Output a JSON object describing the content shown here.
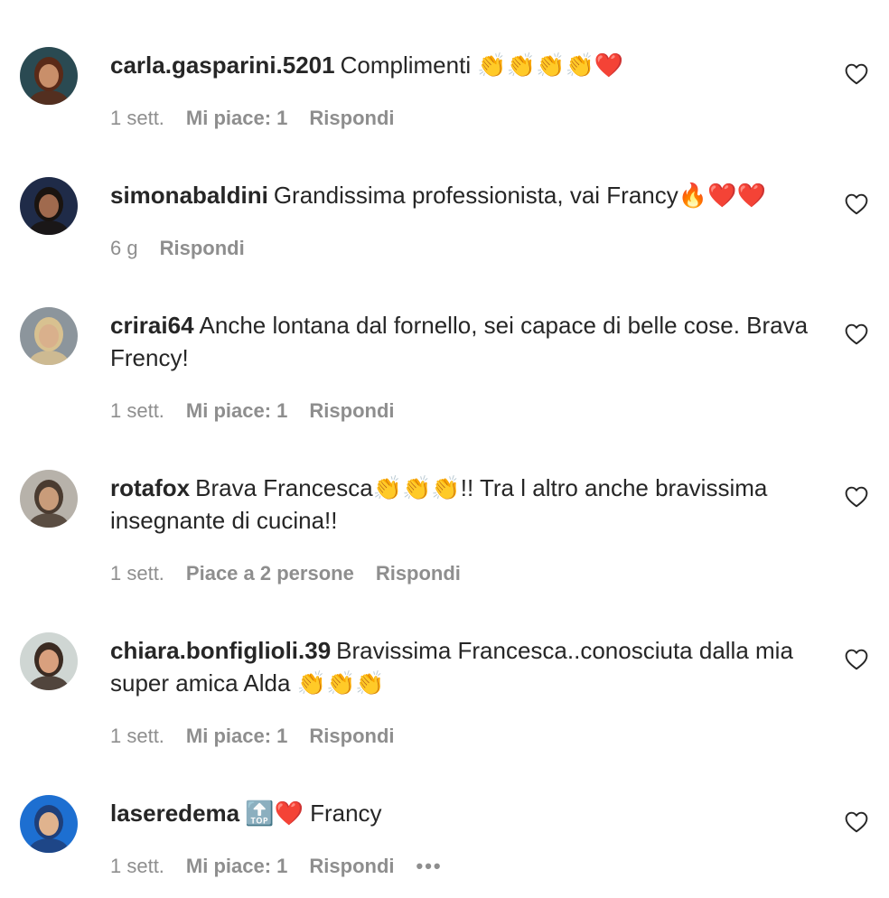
{
  "comments": [
    {
      "username": "carla.gasparini.5201",
      "text": "Complimenti 👏👏👏👏❤️",
      "time": "1 sett.",
      "likes": "Mi piace: 1",
      "reply": "Rispondi",
      "avatar_colors": {
        "bg": "#2a4a52",
        "face": "#c98f6a",
        "hair": "#5a2a18"
      }
    },
    {
      "username": "simonabaldini",
      "text": "Grandissima professionista, vai Francy🔥❤️❤️",
      "time": "6 g",
      "likes": "",
      "reply": "Rispondi",
      "avatar_colors": {
        "bg": "#1f2b48",
        "face": "#a06a4e",
        "hair": "#1a1410"
      }
    },
    {
      "username": "crirai64",
      "text": "Anche lontana dal fornello, sei capace di belle cose. Brava Frency!",
      "time": "1 sett.",
      "likes": "Mi piace: 1",
      "reply": "Rispondi",
      "avatar_colors": {
        "bg": "#8c959c",
        "face": "#d9b08c",
        "hair": "#d8c190"
      }
    },
    {
      "username": "rotafox",
      "text": "Brava Francesca👏👏👏!! Tra l altro anche bravissima insegnante di cucina!!",
      "time": "1 sett.",
      "likes": "Piace a 2 persone",
      "reply": "Rispondi",
      "avatar_colors": {
        "bg": "#b7b2aa",
        "face": "#c99c7a",
        "hair": "#4a3b30"
      }
    },
    {
      "username": "chiara.bonfiglioli.39",
      "text": "Bravissima Francesca..conosciuta dalla mia super amica Alda 👏👏👏",
      "time": "1 sett.",
      "likes": "Mi piace: 1",
      "reply": "Rispondi",
      "avatar_colors": {
        "bg": "#cfd6d3",
        "face": "#d9a07e",
        "hair": "#3b2b22"
      }
    },
    {
      "username": "laseredema",
      "text": "🔝❤️ Francy",
      "time": "1 sett.",
      "likes": "Mi piace: 1",
      "reply": "Rispondi",
      "more": "•••",
      "avatar_colors": {
        "bg": "#1d6fd1",
        "face": "#e0b38e",
        "hair": "#1e3f7a"
      }
    }
  ],
  "icons": {
    "like": "heart-outline-icon",
    "more": "more-horizontal-icon"
  }
}
